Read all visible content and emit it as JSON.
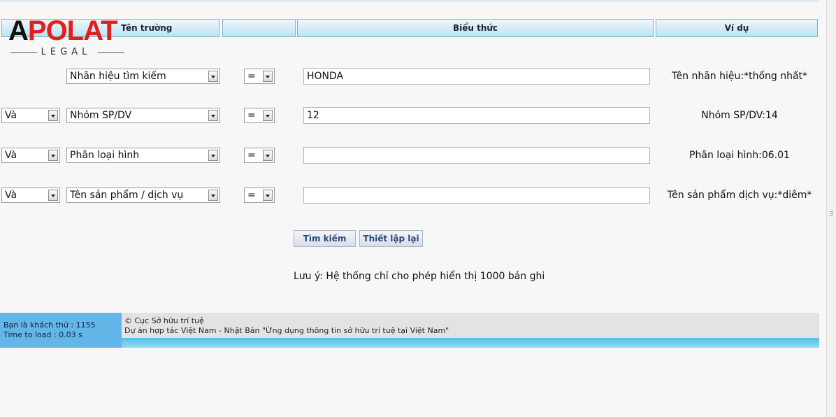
{
  "logo": {
    "word_a": "A",
    "word_rest": "POLAT",
    "tagline": "LEGAL"
  },
  "header": {
    "col_field": "Tên trường",
    "col_op": "",
    "col_expr": "Biểu thức",
    "col_example": "Ví dụ"
  },
  "rows": [
    {
      "logic": "",
      "field": "Nhãn hiệu tìm kiếm",
      "op": "=",
      "value": "HONDA",
      "example": "Tên nhãn hiệu:*thống nhất*"
    },
    {
      "logic": "Và",
      "field": "Nhóm SP/DV",
      "op": "=",
      "value": "12",
      "example": "Nhóm SP/DV:14"
    },
    {
      "logic": "Và",
      "field": "Phân loại hình",
      "op": "=",
      "value": "",
      "example": "Phân loại hình:06.01"
    },
    {
      "logic": "Và",
      "field": "Tên sản phẩm / dịch vụ",
      "op": "=",
      "value": "",
      "example": "Tên sản phẩm dịch vụ:*diêm*"
    }
  ],
  "buttons": {
    "search": "Tìm kiếm",
    "reset": "Thiết lập lại"
  },
  "note": "Lưu ý: Hệ thống chỉ cho phép hiển thị 1000 bản ghi",
  "footer": {
    "visitor": "Bạn là khách thứ : 1155",
    "load_time": "Time to load : 0.03 s",
    "copyright": "© Cục Sở hữu trí tuệ",
    "project": "Dự án hợp tác Việt Nam - Nhật Bản \"Ứng dụng thông tin sở hữu trí tuệ tại Việt Nam\""
  },
  "colors": {
    "accent": "#62b6e8",
    "logo_red": "#e0201d",
    "header_border": "#7fb3cf"
  }
}
